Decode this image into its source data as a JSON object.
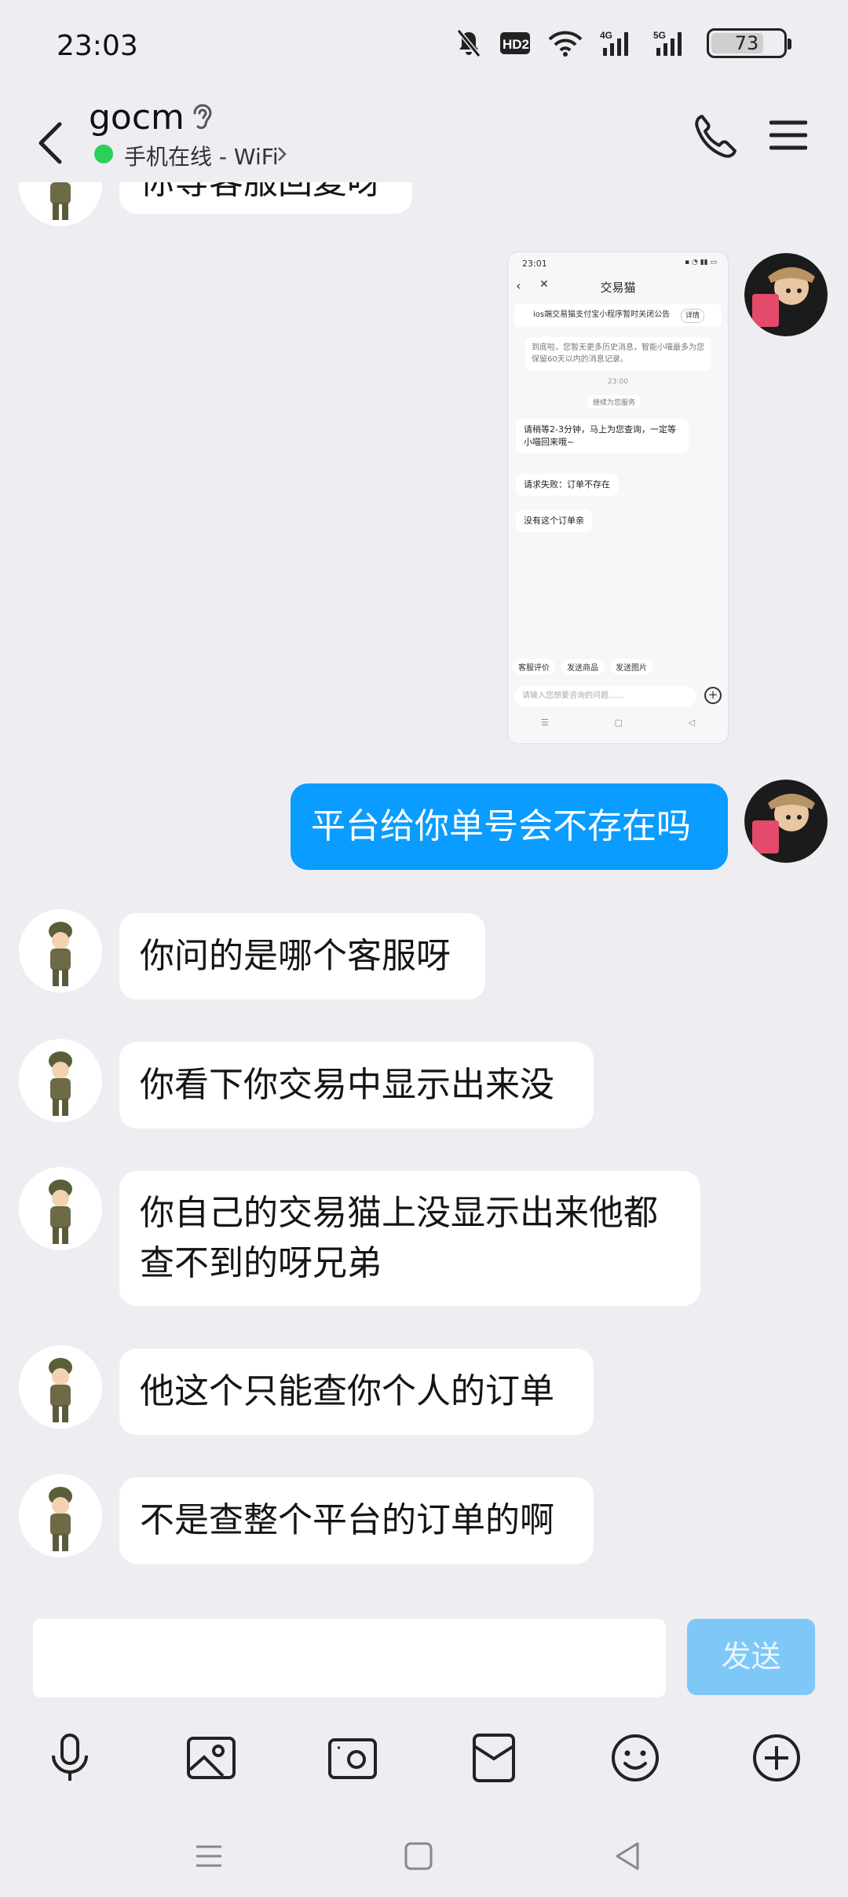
{
  "status_bar": {
    "time": "23:03",
    "network_4g": "4G",
    "network_5g": "5G",
    "hd": "HD2",
    "battery": "73",
    "battery_level_percent": 73
  },
  "header": {
    "contact_name": "gocm",
    "online_status": "手机在线 - WiFi",
    "status_color": "#2bcf5b"
  },
  "messages": [
    {
      "side": "them",
      "text": "你等客服回复呀"
    },
    {
      "side": "me",
      "type": "image"
    },
    {
      "side": "me",
      "text": "平台给你单号会不存在吗"
    },
    {
      "side": "them",
      "text": "你问的是哪个客服呀"
    },
    {
      "side": "them",
      "text": "你看下你交易中显示出来没"
    },
    {
      "side": "them",
      "text": "你自己的交易猫上没显示出来他都查不到的呀兄弟"
    },
    {
      "side": "them",
      "text": "他这个只能查你个人的订单"
    },
    {
      "side": "them",
      "text": "不是查整个平台的订单的啊"
    }
  ],
  "screenshot": {
    "time": "23:01",
    "title": "交易猫",
    "notice": "ios端交易猫支付宝小程序暂时关闭公告",
    "notice_btn": "详情",
    "hint": "到底啦，您暂无更多历史消息，智能小喵最多为您保留60天以内的消息记录。",
    "stamp": "23:00",
    "chip": "继续为您服务",
    "msgs": [
      "请稍等2-3分钟，马上为您查询，一定等小喵回来哦~",
      "请求失败：订单不存在",
      "没有这个订单亲"
    ],
    "tools": [
      "客服评价",
      "发送商品",
      "发送图片"
    ],
    "input_placeholder": "请输入您想要咨询的问题……"
  },
  "input": {
    "value": "",
    "send_label": "发送",
    "send_color": "#7ec8f8"
  },
  "bubble_me_color": "#0a9cff",
  "toolbar": [
    "mic-icon",
    "image-icon",
    "camera-icon",
    "red-packet-icon",
    "emoji-icon",
    "plus-icon"
  ],
  "nav": [
    "menu-icon",
    "home-icon",
    "back-icon"
  ]
}
